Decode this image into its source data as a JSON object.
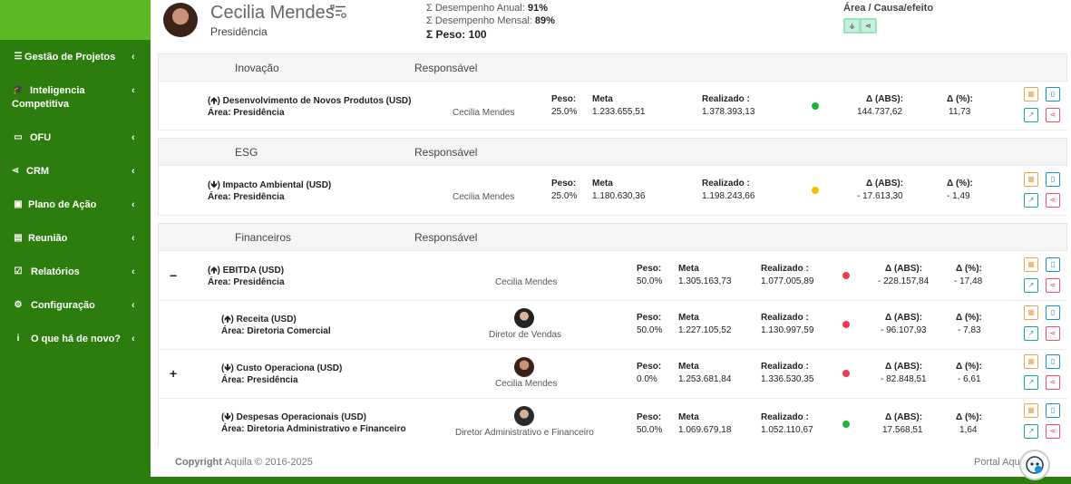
{
  "sidebar": {
    "items": [
      {
        "label": "Gestão de Projetos",
        "icon": "tasks-icon"
      },
      {
        "label": "Inteligencia",
        "label2": "Competitiva",
        "icon": "graduation-cap-icon"
      },
      {
        "label": "OFU",
        "icon": "credit-card-icon"
      },
      {
        "label": "CRM",
        "icon": "share-icon"
      },
      {
        "label": "Plano de Ação",
        "icon": "calendar-check-icon"
      },
      {
        "label": "Reunião",
        "icon": "list-alt-icon"
      },
      {
        "label": "Relatórios",
        "icon": "check-square-icon"
      },
      {
        "label": "Configuração",
        "icon": "gear-icon"
      },
      {
        "label": "O que há de novo?",
        "icon": "info-icon"
      }
    ]
  },
  "header": {
    "name": "Cecilia Mendes",
    "role": "Presidência",
    "stats": {
      "annual_label": "Σ Desempenho Anual:",
      "annual_value": "91%",
      "monthly_label": "Σ Desempenho Mensal:",
      "monthly_value": "89%",
      "weight_label": "Σ Peso:",
      "weight_value": "100"
    },
    "causa_label": "Área / Causa/efeito"
  },
  "labels": {
    "responsavel": "Responsável",
    "peso": "Peso:",
    "meta": "Meta",
    "realizado": "Realizado :",
    "abs": "Δ (ABS):",
    "pct": "Δ (%):",
    "area": "Área:"
  },
  "panels": [
    {
      "category": "Inovação",
      "rows": [
        {
          "title": "(🡹) Desenvolvimento de Novos Produtos (USD)",
          "area": "Presidência",
          "responsible": "Cecilia Mendes",
          "peso": "25.0%",
          "meta": "1.233.655,51",
          "realizado": "1.378.393,13",
          "status": "green",
          "abs": "144.737,62",
          "pct": "11,73"
        }
      ]
    },
    {
      "category": "ESG",
      "rows": [
        {
          "title": "(🡻) Impacto Ambiental (USD)",
          "area": "Presidência",
          "responsible": "Cecilia Mendes",
          "peso": "25.0%",
          "meta": "1.180.630,36",
          "realizado": "1.198.243,66",
          "status": "yellow",
          "abs": "- 17.613,30",
          "pct": "- 1,49"
        }
      ]
    },
    {
      "category": "Financeiros",
      "rows": [
        {
          "toggle": "−",
          "title": "(🡹) EBITDA (USD)",
          "area": "Presidência",
          "responsible": "Cecilia Mendes",
          "peso": "50.0%",
          "meta": "1.305.163,73",
          "realizado": "1.077.005,89",
          "status": "red",
          "abs": "- 228.157,84",
          "pct": "- 17,48"
        },
        {
          "toggle": "",
          "title": "(🡹) Receita (USD)",
          "area": "Diretoria Comercial",
          "responsible": "Diretor de Vendas",
          "peso": "50.0%",
          "meta": "1.227.105,52",
          "realizado": "1.130.997,59",
          "status": "red",
          "abs": "- 96.107,93",
          "pct": "- 7,83"
        },
        {
          "toggle": "+",
          "title": "(🡻) Custo Operaciona (USD)",
          "area": "Presidência",
          "responsible": "Cecilia Mendes",
          "peso": "0.0%",
          "meta": "1.253.681,84",
          "realizado": "1.336.530,35",
          "status": "red",
          "abs": "- 82.848,51",
          "pct": "- 6,61"
        },
        {
          "toggle": "",
          "title": "(🡻) Despesas Operacionais (USD)",
          "area": "Diretoria Administrativo e Financeiro",
          "responsible": "Diretor Administrativo e Financeiro",
          "peso": "50.0%",
          "meta": "1.069.679,18",
          "realizado": "1.052.110,67",
          "status": "green",
          "abs": "17.568,51",
          "pct": "1,64"
        }
      ]
    }
  ],
  "footer": {
    "copy_bold": "Copyright",
    "copy_rest": "Aquila © 2016-2025",
    "right": "Portal Aqu"
  },
  "colors": {
    "green": "#1bb33a",
    "yellow": "#f2c200",
    "red": "#ef3b52",
    "sidebar": "#2d7d0e",
    "logo": "#5db923"
  }
}
